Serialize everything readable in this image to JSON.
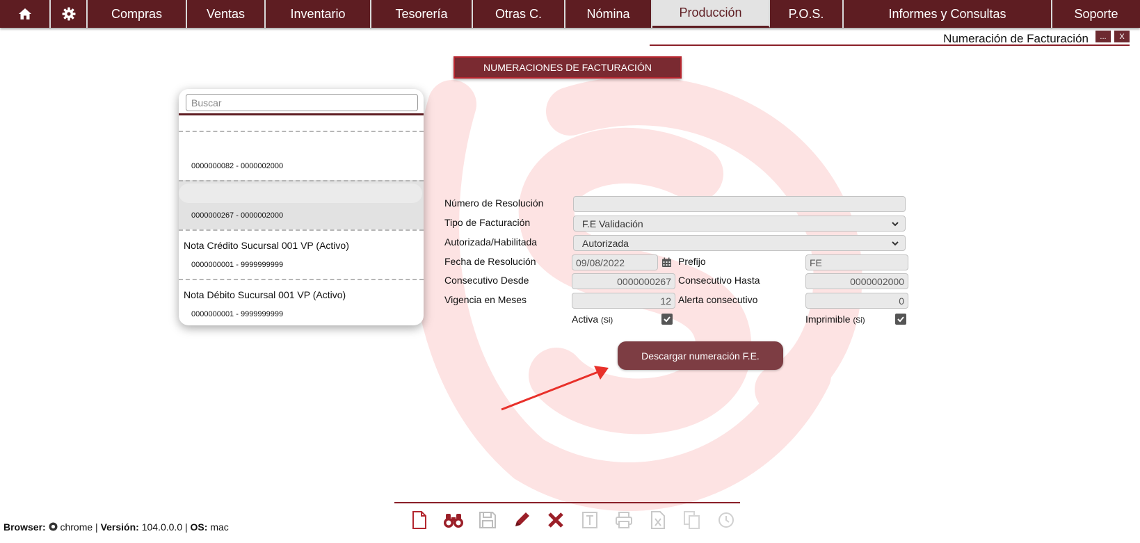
{
  "nav": {
    "items": [
      {
        "label": "",
        "icon": "home-icon"
      },
      {
        "label": "",
        "icon": "gear-icon"
      },
      {
        "label": "Compras"
      },
      {
        "label": "Ventas"
      },
      {
        "label": "Inventario"
      },
      {
        "label": "Tesorería"
      },
      {
        "label": "Otras C."
      },
      {
        "label": "Nómina"
      },
      {
        "label": "Producción",
        "active": true
      },
      {
        "label": "P.O.S."
      },
      {
        "label": "Informes y Consultas"
      },
      {
        "label": "Soporte"
      }
    ]
  },
  "window": {
    "title": "Numeración de Facturación",
    "minimize_label": "...",
    "close_label": "X"
  },
  "header_button": "NUMERACIONES DE FACTURACIÓN",
  "search": {
    "placeholder": "Buscar",
    "value": ""
  },
  "list": {
    "items": [
      {
        "title": "",
        "range": "0000000082 - 0000002000",
        "selected": false
      },
      {
        "title": "",
        "range": "0000000267 - 0000002000",
        "selected": true
      },
      {
        "title": "Nota Crédito Sucursal 001 VP (Activo)",
        "range": "0000000001 - 9999999999",
        "selected": false
      },
      {
        "title": "Nota Débito Sucursal 001 VP (Activo)",
        "range": "0000000001 - 9999999999",
        "selected": false
      }
    ]
  },
  "form": {
    "resolution_number": {
      "label": "Número de Resolución",
      "value": ""
    },
    "billing_type": {
      "label": "Tipo de Facturación",
      "value": "F.E Validación"
    },
    "authorized": {
      "label": "Autorizada/Habilitada",
      "value": "Autorizada"
    },
    "resolution_date": {
      "label": "Fecha de Resolución",
      "value": "09/08/2022"
    },
    "prefix": {
      "label": "Prefijo",
      "value": "FE"
    },
    "from": {
      "label": "Consecutivo Desde",
      "value": "0000000267"
    },
    "to": {
      "label": "Consecutivo Hasta",
      "value": "0000002000"
    },
    "validity": {
      "label": "Vigencia en Meses",
      "value": "12"
    },
    "alert": {
      "label": "Alerta consecutivo",
      "value": "0"
    },
    "active": {
      "label": "Activa",
      "hint": "(Si)",
      "checked": true
    },
    "printable": {
      "label": "Imprimible",
      "hint": "(Si)",
      "checked": true
    }
  },
  "action_button": "Descargar numeración F.E.",
  "toolbar": {
    "icons": [
      "new-document-icon",
      "search-binoculars-icon",
      "save-icon",
      "edit-pencil-icon",
      "delete-x-icon",
      "text-icon",
      "print-icon",
      "excel-export-icon",
      "copy-icon",
      "history-icon"
    ]
  },
  "footer": {
    "browser_label": "Browser:",
    "browser_value": "chrome",
    "version_label": "Versión:",
    "version_value": "104.0.0.0",
    "os_label": "OS:",
    "os_value": "mac",
    "separator": "|"
  },
  "colors": {
    "brand": "#5e1d22",
    "accent_line": "#8a1f28",
    "button": "#7d3d43",
    "arrow": "#e8302a"
  }
}
